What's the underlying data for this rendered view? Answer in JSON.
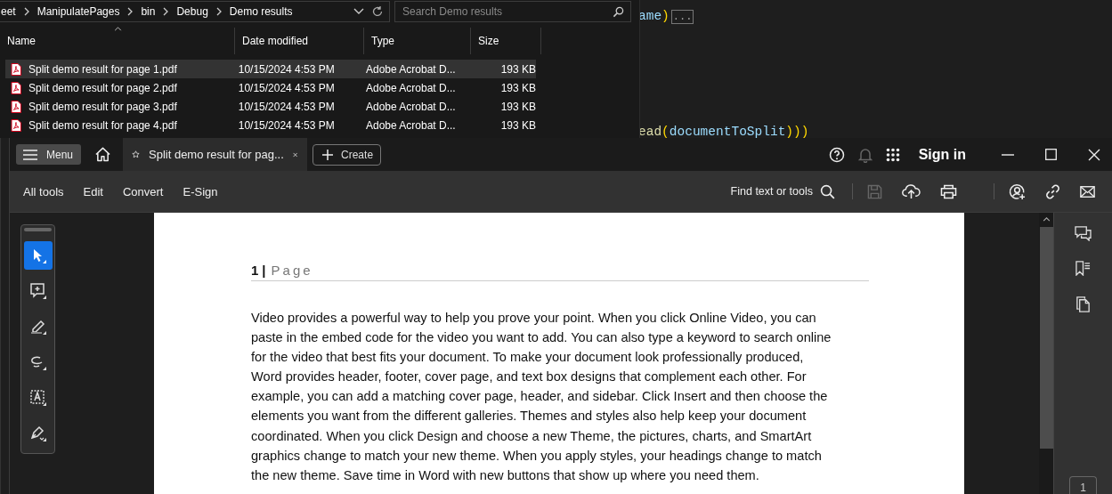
{
  "code_editor": {
    "lines": [
      {
        "tokens": [
          {
            "kind": "identifier",
            "text": "ame"
          },
          {
            "kind": "punct",
            "text": ")"
          },
          {
            "kind": "collapsed",
            "text": "..."
          }
        ]
      },
      {
        "tokens": [
          {
            "kind": "method",
            "text": "ead"
          },
          {
            "kind": "punct",
            "text": "("
          },
          {
            "kind": "identifier",
            "text": "documentToSplit"
          },
          {
            "kind": "punct",
            "text": ")))"
          }
        ]
      }
    ]
  },
  "explorer": {
    "breadcrumb": [
      "eet",
      "ManipulatePages",
      "bin",
      "Debug",
      "Demo results"
    ],
    "search": {
      "placeholder": "Search Demo results"
    },
    "columns": [
      "Name",
      "Date modified",
      "Type",
      "Size"
    ],
    "rows": [
      {
        "name": "Split demo result for page 1.pdf",
        "date": "10/15/2024 4:53 PM",
        "type": "Adobe Acrobat D...",
        "size": "193 KB",
        "selected": true
      },
      {
        "name": "Split demo result for page 2.pdf",
        "date": "10/15/2024 4:53 PM",
        "type": "Adobe Acrobat D...",
        "size": "193 KB",
        "selected": false
      },
      {
        "name": "Split demo result for page 3.pdf",
        "date": "10/15/2024 4:53 PM",
        "type": "Adobe Acrobat D...",
        "size": "193 KB",
        "selected": false
      },
      {
        "name": "Split demo result for page 4.pdf",
        "date": "10/15/2024 4:53 PM",
        "type": "Adobe Acrobat D...",
        "size": "193 KB",
        "selected": false
      }
    ]
  },
  "acrobat": {
    "menu_button": "Menu",
    "tab": {
      "title": "Split demo result for pag..."
    },
    "create_button": "Create",
    "sign_in": "Sign in",
    "toolbar": [
      "All tools",
      "Edit",
      "Convert",
      "E-Sign"
    ],
    "find": "Find text or tools",
    "tools": [
      {
        "kind": "select",
        "selected": true
      },
      {
        "kind": "comment",
        "selected": false
      },
      {
        "kind": "highlight",
        "selected": false
      },
      {
        "kind": "draw",
        "selected": false
      },
      {
        "kind": "textbox",
        "selected": false
      },
      {
        "kind": "sign",
        "selected": false
      }
    ],
    "page": {
      "header": {
        "number": "1",
        "separator": "|",
        "label": "Page"
      },
      "paragraph": [
        "Video provides a powerful way to help you prove your point. When you click Online Video, you can",
        "paste in the embed code for the video you want to add. You can also type a keyword to search online",
        "for the video that best fits your document. To make your document look professionally produced,",
        "Word provides header, footer, cover page, and text box designs that complement each other. For",
        "example, you can add a matching cover page, header, and sidebar. Click Insert and then choose the",
        "elements you want from the different galleries. Themes and styles also help keep your document",
        "coordinated. When you click Design and choose a new Theme, the pictures, charts, and SmartArt",
        "graphics change to match your new theme. When you apply styles, your headings change to match",
        "the new theme. Save time in Word with new buttons that show up where you need them."
      ]
    },
    "page_indicator": "1"
  }
}
